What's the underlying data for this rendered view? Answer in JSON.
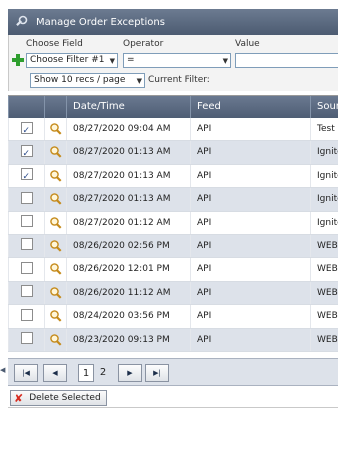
{
  "window": {
    "title": "Manage Order Exceptions"
  },
  "filter": {
    "choose_field_label": "Choose Field",
    "operator_label": "Operator",
    "value_label": "Value",
    "field_selected": "Choose Filter #1",
    "operator_selected": "=",
    "value": "",
    "page_size_selected": "Show 10 recs / page",
    "current_filter_label": "Current Filter:"
  },
  "grid": {
    "columns": [
      "",
      "",
      "Date/Time",
      "Feed",
      "Sourc"
    ],
    "rows": [
      {
        "checked": true,
        "datetime": "08/27/2020 09:04 AM",
        "feed": "API",
        "source": "Test Sc"
      },
      {
        "checked": true,
        "datetime": "08/27/2020 01:13 AM",
        "feed": "API",
        "source": "Ignite"
      },
      {
        "checked": true,
        "datetime": "08/27/2020 01:13 AM",
        "feed": "API",
        "source": "Ignite"
      },
      {
        "checked": false,
        "datetime": "08/27/2020 01:13 AM",
        "feed": "API",
        "source": "Ignite"
      },
      {
        "checked": false,
        "datetime": "08/27/2020 01:12 AM",
        "feed": "API",
        "source": "Ignite"
      },
      {
        "checked": false,
        "datetime": "08/26/2020 02:56 PM",
        "feed": "API",
        "source": "WEB -"
      },
      {
        "checked": false,
        "datetime": "08/26/2020 12:01 PM",
        "feed": "API",
        "source": "WEB -"
      },
      {
        "checked": false,
        "datetime": "08/26/2020 11:12 AM",
        "feed": "API",
        "source": "WEB -"
      },
      {
        "checked": false,
        "datetime": "08/24/2020 03:56 PM",
        "feed": "API",
        "source": "WEB -"
      },
      {
        "checked": false,
        "datetime": "08/23/2020 09:13 PM",
        "feed": "API",
        "source": "WEB -"
      }
    ]
  },
  "pager": {
    "pages": [
      "1",
      "2"
    ],
    "current": "1"
  },
  "actions": {
    "delete_label": "Delete Selected"
  },
  "colors": {
    "header": "#4e5d74",
    "alt_row": "#dde2ea",
    "delete_icon": "#d62b1f",
    "add_icon": "#2e9e2e"
  }
}
